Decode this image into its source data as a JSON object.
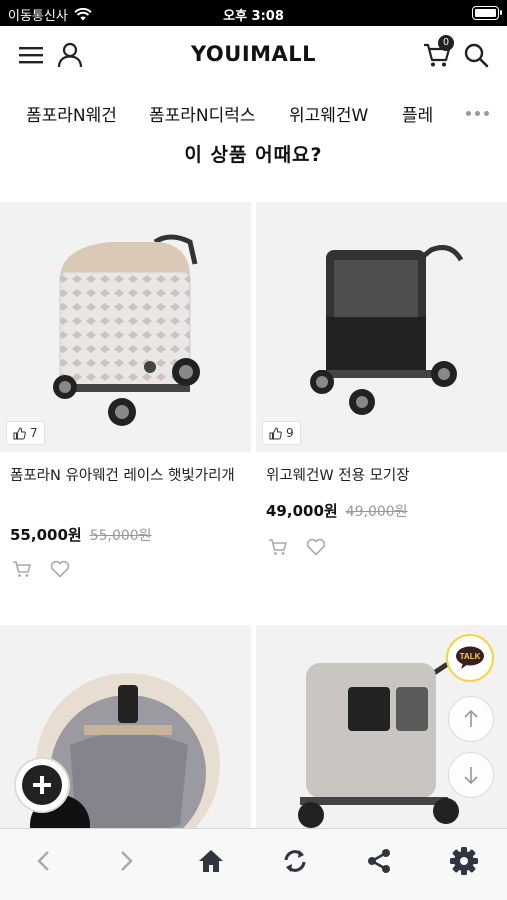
{
  "status_bar": {
    "carrier": "이동통신사",
    "time": "오후 3:08"
  },
  "header": {
    "logo": "YOUIMALL",
    "cart_count": "0"
  },
  "categories": [
    "폼포라N웨건",
    "폼포라N디럭스",
    "위고웨건W",
    "플레"
  ],
  "section_title": "이 상품 어때요?",
  "products": [
    {
      "name": "폼포라N 유아웨건 레이스 햇빛가리개",
      "likes": "7",
      "price": "55,000원",
      "original_price": "55,000원"
    },
    {
      "name": "위고웨건W 전용 모기장",
      "likes": "9",
      "price": "49,000원",
      "original_price": "49,000원"
    }
  ],
  "talk_label": "TALK",
  "colors": {
    "accent": "#222222",
    "talk_border": "#f2d640",
    "talk_bubble": "#3a1d1d"
  }
}
